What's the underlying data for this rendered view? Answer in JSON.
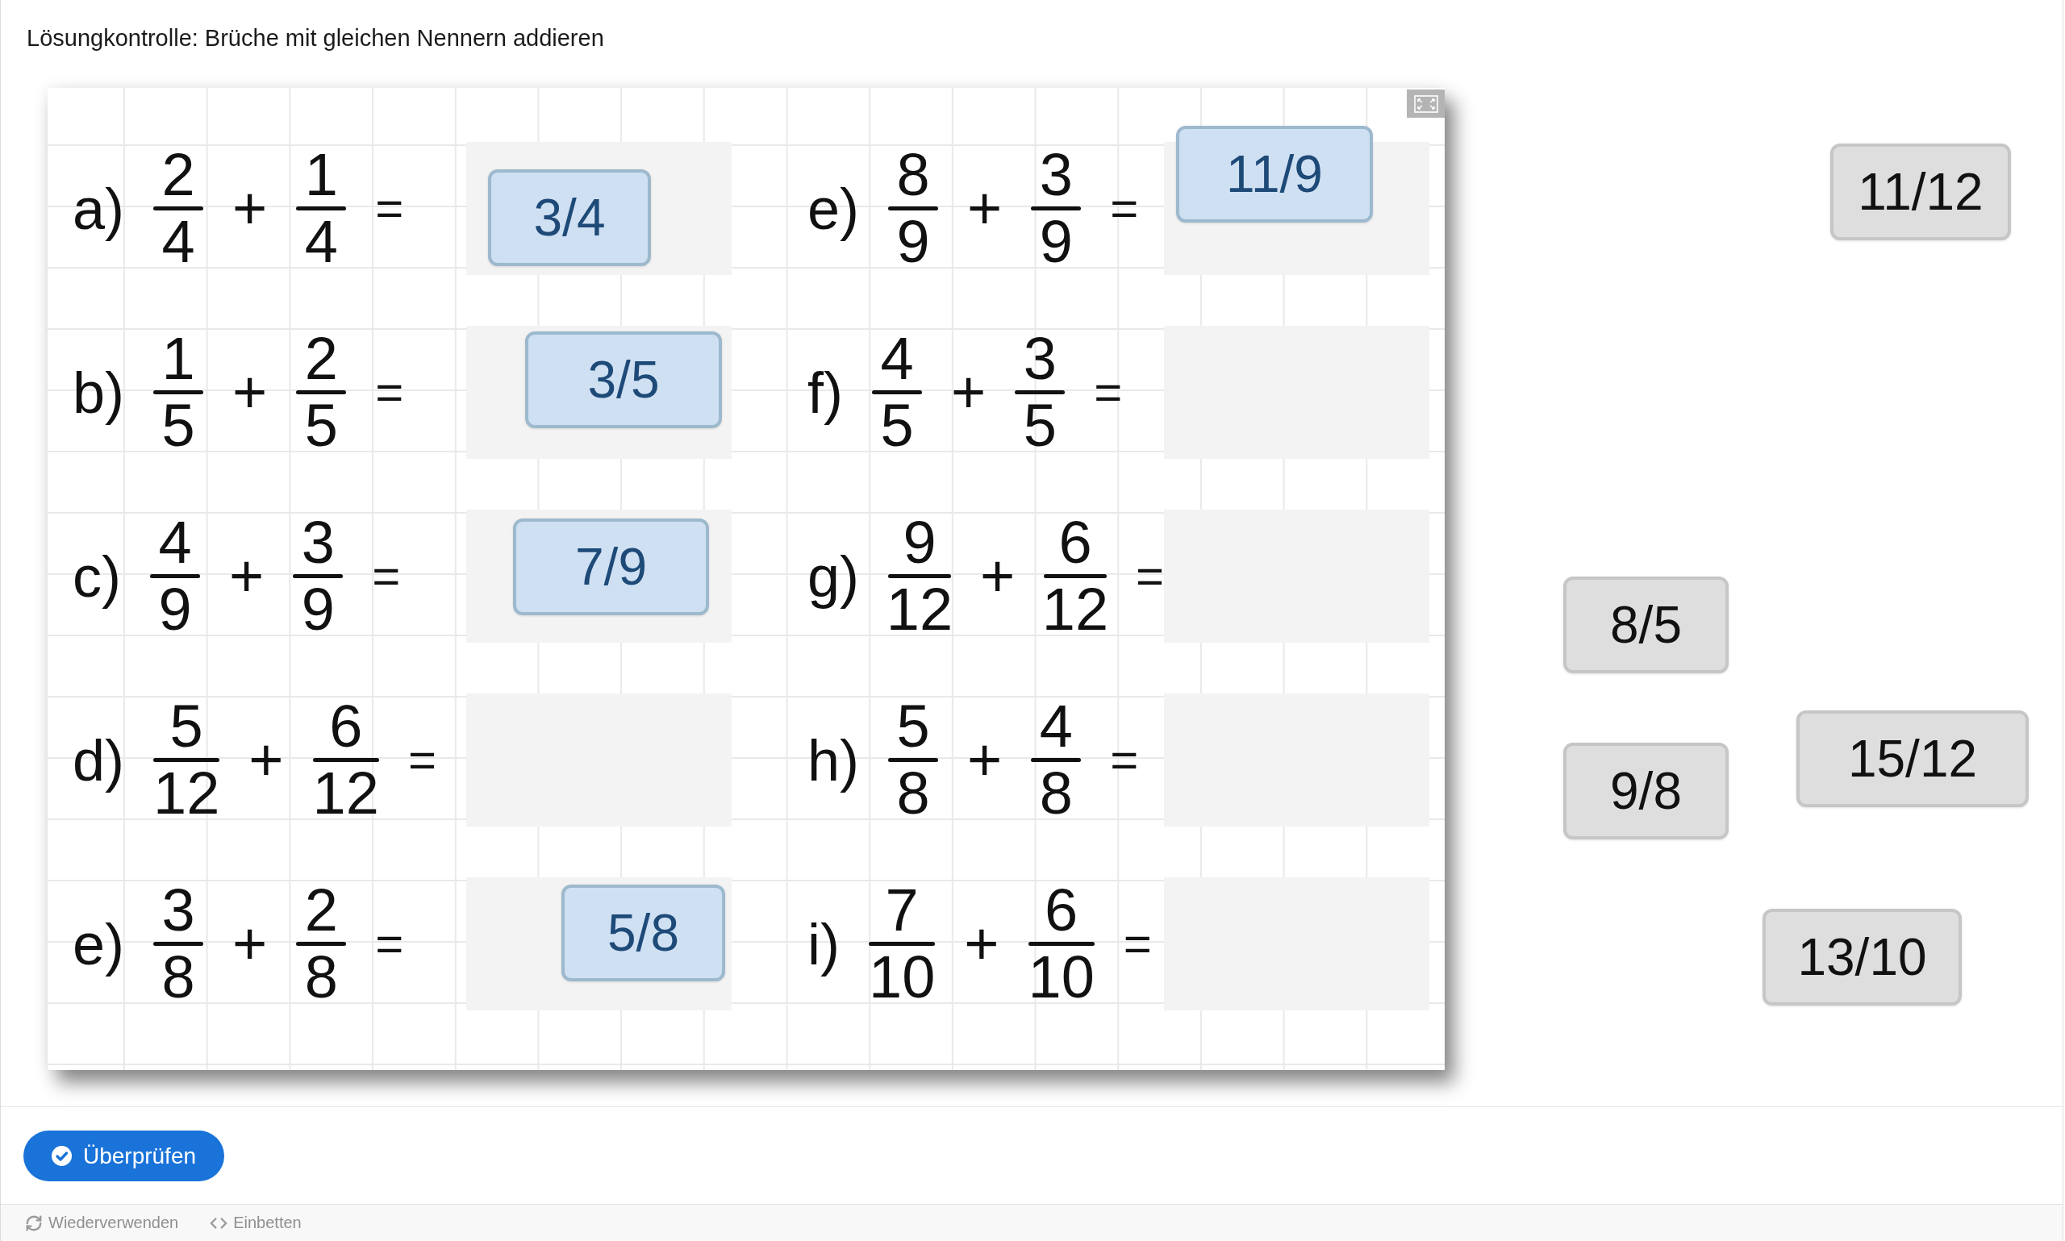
{
  "title": "Lösungkontrolle: Brüche mit gleichen Nennern addieren",
  "worksheet": {
    "columns": [
      {
        "tasks": [
          {
            "label": "a)",
            "fractions": [
              {
                "numerator": "2",
                "denominator": "4"
              },
              {
                "numerator": "1",
                "denominator": "4"
              }
            ],
            "operator": "+",
            "equals": "=",
            "answer": "3/4"
          },
          {
            "label": "b)",
            "fractions": [
              {
                "numerator": "1",
                "denominator": "5"
              },
              {
                "numerator": "2",
                "denominator": "5"
              }
            ],
            "operator": "+",
            "equals": "=",
            "answer": "3/5"
          },
          {
            "label": "c)",
            "fractions": [
              {
                "numerator": "4",
                "denominator": "9"
              },
              {
                "numerator": "3",
                "denominator": "9"
              }
            ],
            "operator": "+",
            "equals": "=",
            "answer": "7/9"
          },
          {
            "label": "d)",
            "fractions": [
              {
                "numerator": "5",
                "denominator": "12"
              },
              {
                "numerator": "6",
                "denominator": "12"
              }
            ],
            "operator": "+",
            "equals": "="
          },
          {
            "label": "e)",
            "fractions": [
              {
                "numerator": "3",
                "denominator": "8"
              },
              {
                "numerator": "2",
                "denominator": "8"
              }
            ],
            "operator": "+",
            "equals": "=",
            "answer": "5/8"
          }
        ]
      },
      {
        "tasks": [
          {
            "label": "e)",
            "fractions": [
              {
                "numerator": "8",
                "denominator": "9"
              },
              {
                "numerator": "3",
                "denominator": "9"
              }
            ],
            "operator": "+",
            "equals": "=",
            "answer": "11/9"
          },
          {
            "label": "f)",
            "fractions": [
              {
                "numerator": "4",
                "denominator": "5"
              },
              {
                "numerator": "3",
                "denominator": "5"
              }
            ],
            "operator": "+",
            "equals": "="
          },
          {
            "label": "g)",
            "fractions": [
              {
                "numerator": "9",
                "denominator": "12"
              },
              {
                "numerator": "6",
                "denominator": "12"
              }
            ],
            "operator": "+",
            "equals": "="
          },
          {
            "label": "h)",
            "fractions": [
              {
                "numerator": "5",
                "denominator": "8"
              },
              {
                "numerator": "4",
                "denominator": "8"
              }
            ],
            "operator": "+",
            "equals": "="
          },
          {
            "label": "i)",
            "fractions": [
              {
                "numerator": "7",
                "denominator": "10"
              },
              {
                "numerator": "6",
                "denominator": "10"
              }
            ],
            "operator": "+",
            "equals": "="
          }
        ]
      }
    ]
  },
  "answer_pool": [
    {
      "text": "11/12"
    },
    {
      "text": "8/5"
    },
    {
      "text": "9/8"
    },
    {
      "text": "15/12"
    },
    {
      "text": "13/10"
    }
  ],
  "check_button": {
    "label": "Überprüfen"
  },
  "footer": {
    "actions": [
      {
        "kind": "reuse",
        "label": "Wiederverwenden"
      },
      {
        "kind": "embed",
        "label": "Einbetten"
      }
    ]
  }
}
